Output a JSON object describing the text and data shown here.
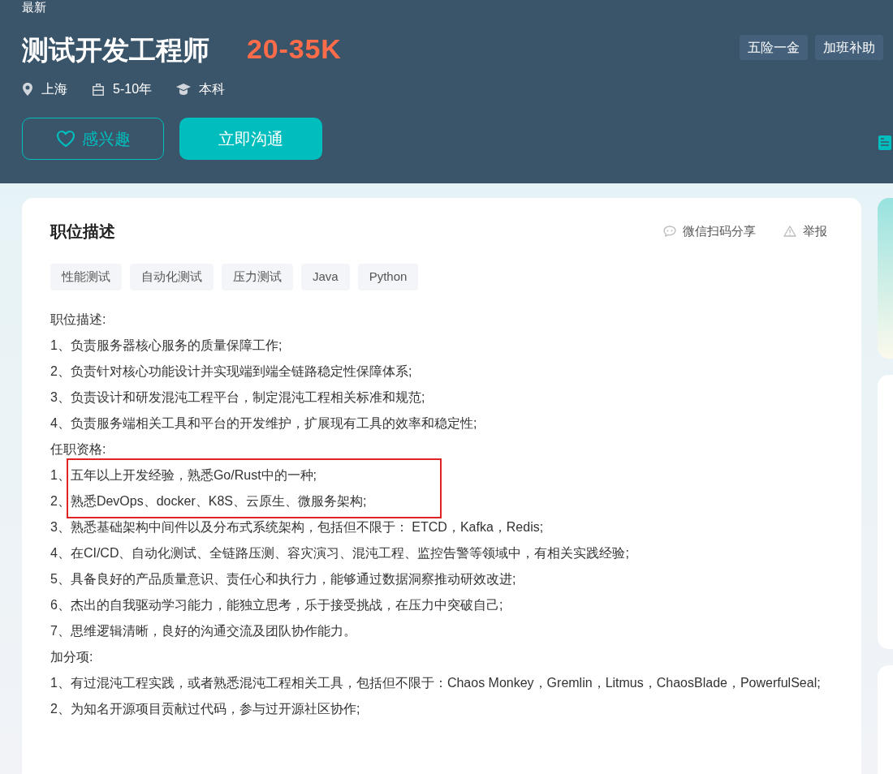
{
  "header": {
    "badge": "最新",
    "title": "测试开发工程师",
    "salary": "20-35K",
    "meta": [
      {
        "kind": "location",
        "text": "上海"
      },
      {
        "kind": "experience",
        "text": "5-10年"
      },
      {
        "kind": "education",
        "text": "本科"
      }
    ],
    "benefits": [
      "五险一金",
      "加班补助"
    ],
    "buttons": {
      "interest": "感兴趣",
      "chat": "立即沟通"
    }
  },
  "card": {
    "title": "职位描述",
    "actions": [
      {
        "kind": "share",
        "text": "微信扫码分享"
      },
      {
        "kind": "report",
        "text": "举报"
      }
    ],
    "tags": [
      "性能测试",
      "自动化测试",
      "压力测试",
      "Java",
      "Python"
    ],
    "lines": [
      {
        "text": "职位描述:",
        "highlighted": false
      },
      {
        "text": "1、负责服务器核心服务的质量保障工作;",
        "highlighted": false
      },
      {
        "text": "2、负责针对核心功能设计并实现端到端全链路稳定性保障体系;",
        "highlighted": false
      },
      {
        "text": "3、负责设计和研发混沌工程平台，制定混沌工程相关标准和规范;",
        "highlighted": false
      },
      {
        "text": "4、负责服务端相关工具和平台的开发维护，扩展现有工具的效率和稳定性;",
        "highlighted": false
      },
      {
        "text": "任职资格:",
        "highlighted": false
      },
      {
        "text": "1、五年以上开发经验，熟悉Go/Rust中的一种;",
        "highlighted": true
      },
      {
        "text": "2、熟悉DevOps、docker、K8S、云原生、微服务架构;",
        "highlighted": true
      },
      {
        "text": "3、熟悉基础架构中间件以及分布式系统架构，包括但不限于： ETCD，Kafka，Redis;",
        "highlighted": false
      },
      {
        "text": "4、在CI/CD、自动化测试、全链路压测、容灾演习、混沌工程、监控告警等领域中，有相关实践经验;",
        "highlighted": false
      },
      {
        "text": "5、具备良好的产品质量意识、责任心和执行力，能够通过数据洞察推动研效改进;",
        "highlighted": false
      },
      {
        "text": "6、杰出的自我驱动学习能力，能独立思考，乐于接受挑战，在压力中突破自己;",
        "highlighted": false
      },
      {
        "text": "7、思维逻辑清晰，良好的沟通交流及团队协作能力。",
        "highlighted": false
      },
      {
        "text": "加分项:",
        "highlighted": false
      },
      {
        "text": "1、有过混沌工程实践，或者熟悉混沌工程相关工具，包括但不限于：Chaos Monkey，Gremlin，Litmus，ChaosBlade，PowerfulSeal;",
        "highlighted": false
      },
      {
        "text": "2、为知名开源项目贡献过代码，参与过开源社区协作;",
        "highlighted": false
      }
    ]
  }
}
